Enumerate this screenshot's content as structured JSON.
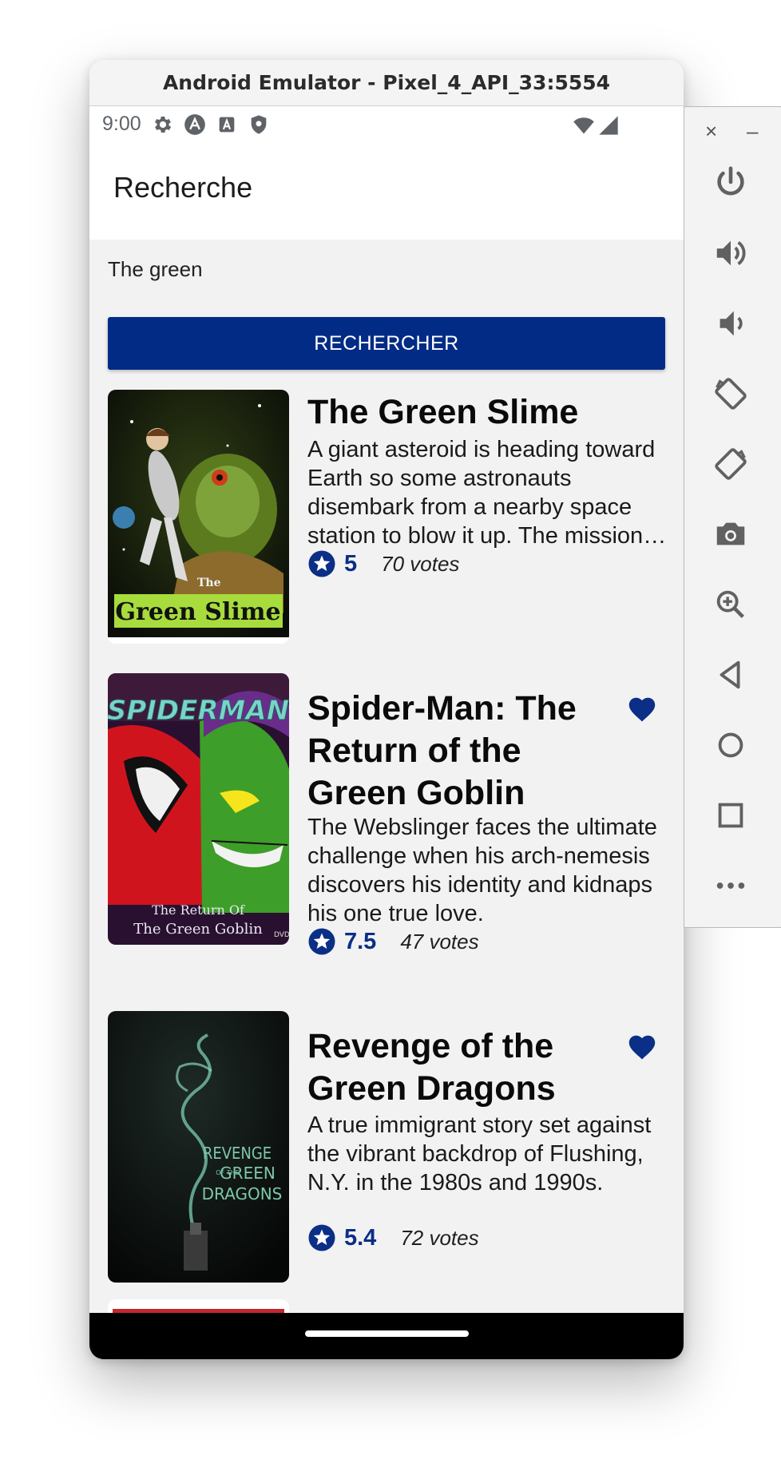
{
  "window": {
    "title": "Android Emulator - Pixel_4_API_33:5554"
  },
  "status_bar": {
    "time": "9:00"
  },
  "app_bar": {
    "title": "Recherche"
  },
  "search": {
    "value": "The green",
    "button_label": "RECHERCHER"
  },
  "movies": [
    {
      "title": "The Green Slime",
      "description": "A giant asteroid is heading toward Earth so some astronauts disembark from a nearby space station to blow it up. The mission succeeds, but the astronauts unknowingly bring back a mysterious green substance.",
      "rating": "5",
      "votes": "70 votes",
      "favorite": false,
      "poster_text": [
        "The",
        "Green Slime"
      ]
    },
    {
      "title": "Spider-Man: The Return of the Green Goblin",
      "description": "The Webslinger faces the ultimate challenge when his arch-nemesis discovers his identity and kidnaps his one true love.",
      "rating": "7.5",
      "votes": "47 votes",
      "favorite": true,
      "poster_text": [
        "SPIDERMAN",
        "The Return Of",
        "The Green Goblin",
        "DVD"
      ]
    },
    {
      "title": "Revenge of the Green Dragons",
      "description": "A true immigrant story set against the vibrant backdrop of Flushing, N.Y. in the 1980s and 1990s.",
      "rating": "5.4",
      "votes": "72 votes",
      "favorite": true,
      "poster_text": [
        "REVENGE",
        "OF THE",
        "GREEN",
        "DRAGONS"
      ]
    }
  ],
  "colors": {
    "primary": "#022b86",
    "rating": "#0b2f86",
    "background": "#f2f2f2"
  },
  "toolbar": {
    "close": "×",
    "minimize": "–",
    "buttons": [
      "power-icon",
      "volume-up-icon",
      "volume-down-icon",
      "rotate-left-icon",
      "rotate-right-icon",
      "camera-icon",
      "zoom-icon",
      "back-icon",
      "home-icon",
      "overview-icon",
      "more-icon"
    ]
  }
}
